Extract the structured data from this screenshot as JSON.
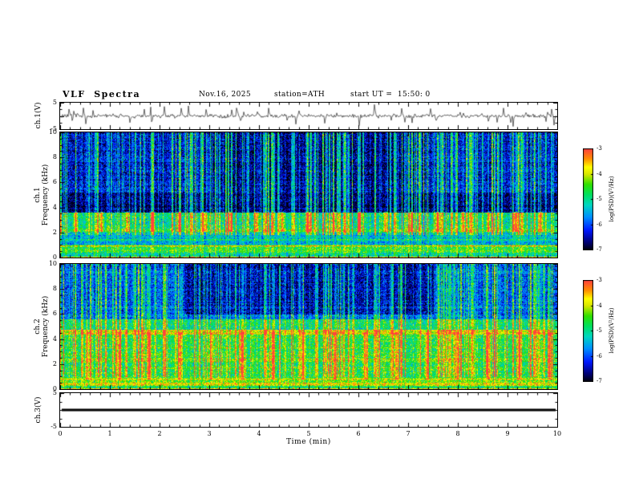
{
  "header": {
    "title": "VLF  Spectra",
    "date": "Nov.16, 2025",
    "station": "station=ATH",
    "start_ut": "start UT =  15:50: 0"
  },
  "xaxis": {
    "label": "Time  (min)",
    "range": [
      0,
      10
    ],
    "major_ticks": [
      0,
      1,
      2,
      3,
      4,
      5,
      6,
      7,
      8,
      9,
      10
    ],
    "minor_step": 0.2
  },
  "colormap": {
    "value_range": [
      -7,
      -3
    ],
    "stops": [
      [
        "#000000",
        0
      ],
      [
        "#000070",
        0.08
      ],
      [
        "#0018ff",
        0.2
      ],
      [
        "#0090ff",
        0.33
      ],
      [
        "#00d8c0",
        0.45
      ],
      [
        "#00e060",
        0.55
      ],
      [
        "#30e000",
        0.65
      ],
      [
        "#d8e800",
        0.75
      ],
      [
        "#ffff00",
        0.82
      ],
      [
        "#ff9000",
        0.9
      ],
      [
        "#ff4040",
        1.0
      ]
    ]
  },
  "chart_data": [
    {
      "id": "ch1_waveform",
      "type": "line",
      "ylabel": "ch.1(V)",
      "ylim": [
        -5,
        5
      ],
      "yticks_labeled": [
        5,
        -5
      ],
      "signal": {
        "kind": "noisy",
        "baseline": 0,
        "noise_amp": 0.6,
        "spike_count": 48,
        "spike_amp_max": 4,
        "seed": 3
      }
    },
    {
      "id": "ch1_spectrogram",
      "type": "heatmap",
      "ylabel_line1": "ch.1",
      "ylabel_line2": "Frequency (kHz)",
      "ylim": [
        0,
        10
      ],
      "yticks_labeled": [
        0,
        2,
        4,
        6,
        8,
        10
      ],
      "value_range": [
        -7,
        -3
      ],
      "seed": 7,
      "noise": 0.45,
      "bands": [
        [
          0,
          0.12,
          -3.7
        ],
        [
          0.12,
          0.4,
          -5.2
        ],
        [
          0.4,
          1.05,
          -4.6
        ],
        [
          1.05,
          2.0,
          -5.4
        ],
        [
          2.0,
          2.35,
          -4.8
        ],
        [
          2.35,
          3.6,
          -5.1
        ],
        [
          3.6,
          5.2,
          -6.7
        ],
        [
          5.2,
          10.01,
          -6.3
        ]
      ],
      "lines": [
        [
          0.95,
          -3.8,
          0.06
        ],
        [
          0.55,
          -4.3,
          0.06
        ],
        [
          1.45,
          -4.6,
          0.07
        ],
        [
          2.15,
          -4.5,
          0.08
        ],
        [
          3.1,
          -5.0,
          0.1
        ]
      ],
      "streaks": {
        "count": 260,
        "amp_min": 0.3,
        "amp_max": 1.9,
        "fmin": 1.8
      },
      "events": {
        "start": 0.3,
        "period": 0.52,
        "amp": 1.6,
        "f0": 2.1,
        "f1": 3.7
      },
      "patches": [
        [
          3,
          7,
          5.2,
          10,
          -0.3
        ]
      ],
      "colorbar": {
        "label": "log(PSD)(V²/Hz)",
        "ticks": [
          -3,
          -4,
          -5,
          -6,
          -7
        ]
      }
    },
    {
      "id": "ch2_spectrogram",
      "type": "heatmap",
      "ylabel_line1": "ch.2",
      "ylabel_line2": "Frequency (kHz)",
      "ylim": [
        0,
        10
      ],
      "yticks_labeled": [
        0,
        2,
        4,
        6,
        8,
        10
      ],
      "value_range": [
        -7,
        -3
      ],
      "seed": 13,
      "noise": 0.45,
      "bands": [
        [
          0,
          0.12,
          -3.7
        ],
        [
          0.12,
          0.3,
          -4.9
        ],
        [
          0.3,
          0.45,
          -4.0
        ],
        [
          0.45,
          0.75,
          -4.5
        ],
        [
          0.75,
          0.95,
          -4.15
        ],
        [
          0.95,
          2.2,
          -4.8
        ],
        [
          2.2,
          2.45,
          -4.35
        ],
        [
          2.45,
          4.4,
          -4.75
        ],
        [
          4.4,
          4.75,
          -3.95
        ],
        [
          4.75,
          5.6,
          -5.0
        ],
        [
          5.6,
          10.01,
          -5.9
        ]
      ],
      "lines": [
        [
          0.5,
          -3.6,
          0.05
        ],
        [
          1.35,
          -4.4,
          0.07
        ],
        [
          1.8,
          -4.5,
          0.07
        ],
        [
          3.3,
          -4.45,
          0.08
        ],
        [
          3.9,
          -4.55,
          0.07
        ]
      ],
      "streaks": {
        "count": 240,
        "amp_min": 0.3,
        "amp_max": 1.7,
        "fmin": 1.0
      },
      "events": {
        "start": 0.55,
        "period": 0.62,
        "amp": 1.2,
        "f0": 0.8,
        "f1": 4.6
      },
      "patches": [
        [
          2.5,
          7.5,
          6,
          10,
          -0.55
        ]
      ],
      "colorbar": {
        "label": "log(PSD)(V²/Hz)",
        "ticks": [
          -3,
          -4,
          -5,
          -6,
          -7
        ]
      }
    },
    {
      "id": "ch3_waveform",
      "type": "line",
      "ylabel": "ch.3(V)",
      "ylim": [
        -5,
        5
      ],
      "yticks_labeled": [
        5,
        -5
      ],
      "signal": {
        "kind": "flat",
        "baseline": 0,
        "thickness": 3
      }
    }
  ]
}
